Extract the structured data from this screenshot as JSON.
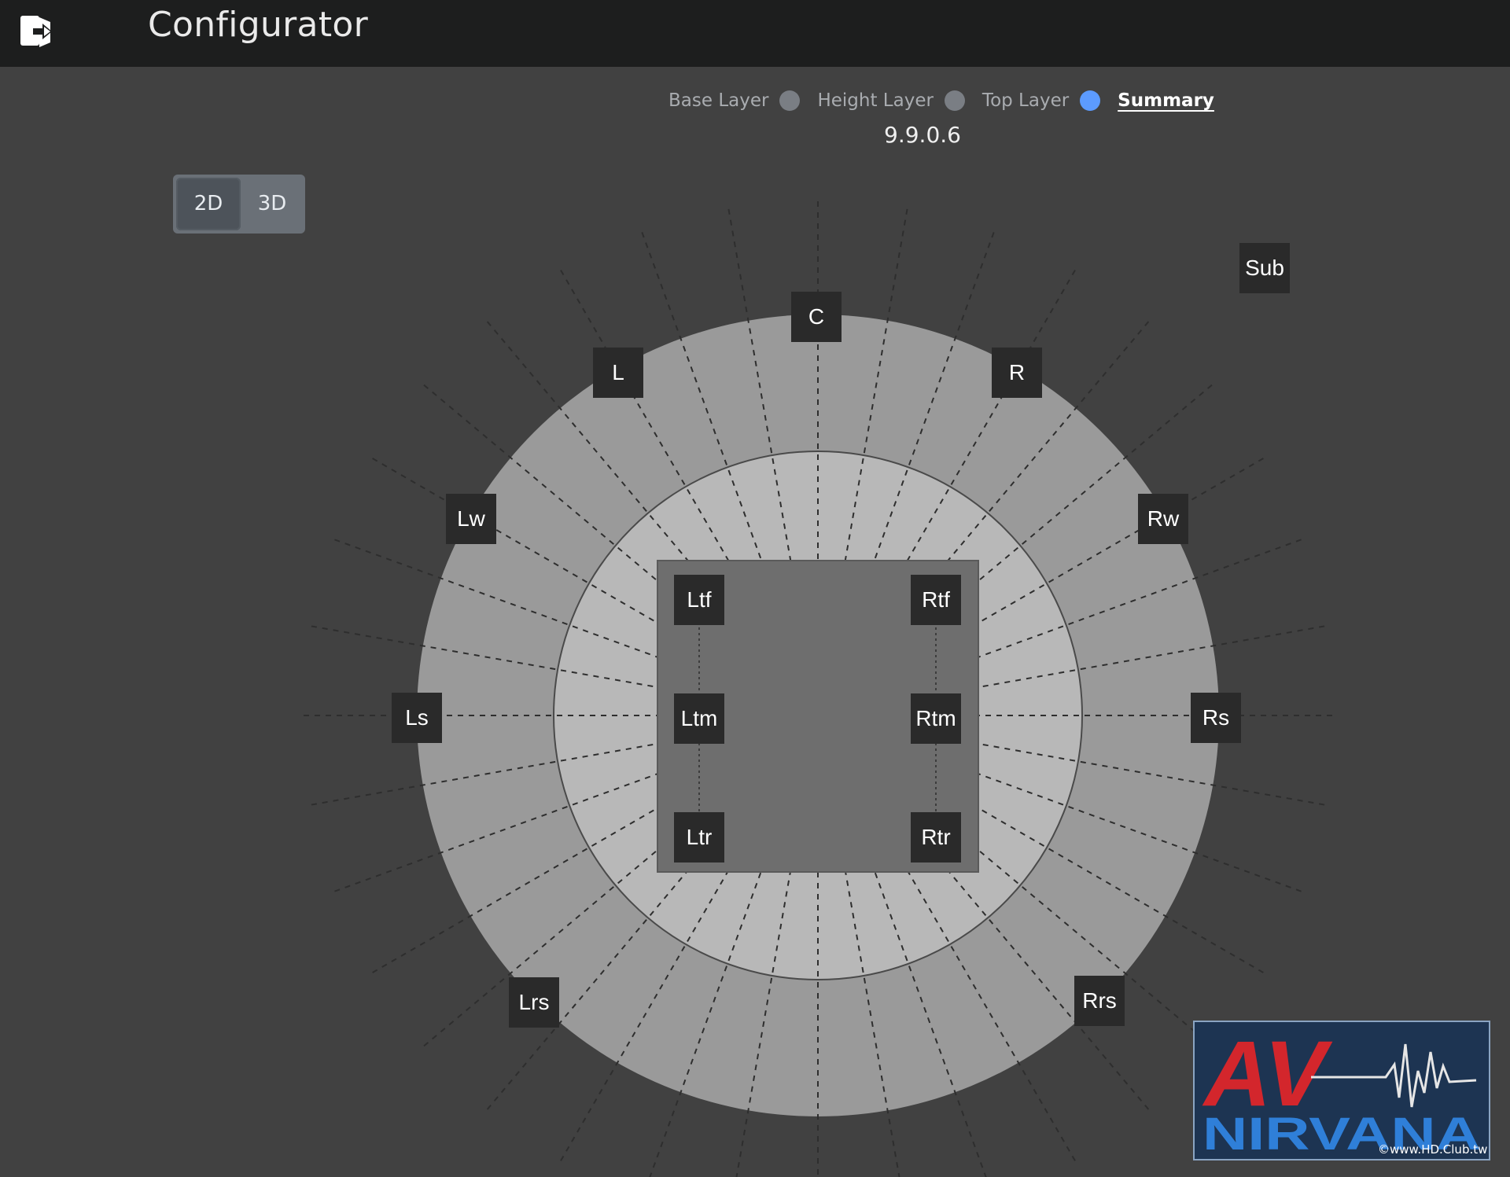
{
  "header": {
    "title": "Configurator",
    "exit_icon": "logout-icon"
  },
  "layers": {
    "tabs": [
      {
        "label": "Base Layer",
        "active": false
      },
      {
        "label": "Height Layer",
        "active": false
      },
      {
        "label": "Top Layer",
        "active": false
      },
      {
        "label": "Summary",
        "active": true
      }
    ],
    "version": "9.9.0.6"
  },
  "view_toggle": {
    "options": [
      "2D",
      "3D"
    ],
    "selected": "2D"
  },
  "speakers": {
    "C": "C",
    "L": "L",
    "R": "R",
    "Lw": "Lw",
    "Rw": "Rw",
    "Ls": "Ls",
    "Rs": "Rs",
    "Lrs": "Lrs",
    "Rrs": "Rrs",
    "Ltf": "Ltf",
    "Rtf": "Rtf",
    "Ltm": "Ltm",
    "Rtm": "Rtm",
    "Ltr": "Ltr",
    "Rtr": "Rtr",
    "Sub": "Sub"
  },
  "logo": {
    "text_top": "AV",
    "text_bottom": "NIRVANA"
  },
  "watermark": "©www.HD.Club.tw",
  "colors": {
    "active_dot": "#5c9bff",
    "inactive_dot": "#7a7e84",
    "background": "#414141"
  }
}
